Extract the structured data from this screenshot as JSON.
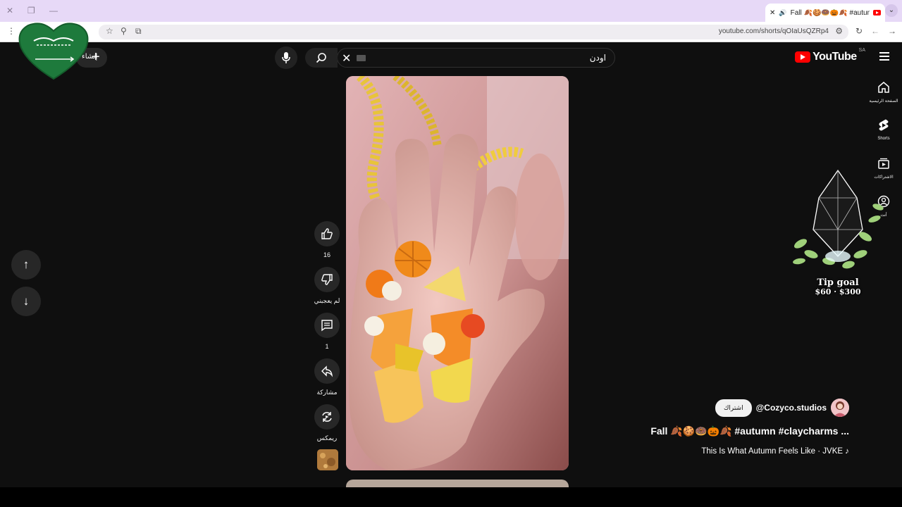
{
  "browser": {
    "tab_title": "Fall 🍂🍪🍩🎃🍂 #autumn",
    "url": "youtube.com/shorts/qOIaUsQZRp4"
  },
  "header": {
    "logo_text": "YouTube",
    "country_code": "SA",
    "search_query": "اودن",
    "create_label": "إنشاء"
  },
  "sidebar": {
    "items": [
      {
        "label": "الصفحة الرئيسية",
        "icon": "home-icon"
      },
      {
        "label": "Shorts",
        "icon": "shorts-icon"
      },
      {
        "label": "الاشتراكات",
        "icon": "subscriptions-icon"
      },
      {
        "label": "أنت",
        "icon": "you-icon"
      }
    ]
  },
  "actions": {
    "like_count": "16",
    "dislike_label": "لم يعجبني",
    "comment_count": "1",
    "share_label": "مشاركة",
    "remix_label": "ريمكس"
  },
  "overlay": {
    "tip_title": "Tip goal",
    "tip_amount": "$60 · $300"
  },
  "video": {
    "channel": "@Cozyco.studios",
    "subscribe_label": "اشتراك",
    "title": "Fall 🍂🍪🍩🎃🍂 #autumn #claycharms ...",
    "music": "This Is What Autumn Feels Like · JVKE ♪"
  },
  "colors": {
    "background": "#0f0f0f",
    "youtube_red": "#ff0000",
    "tab_strip": "#e7d9f7"
  }
}
